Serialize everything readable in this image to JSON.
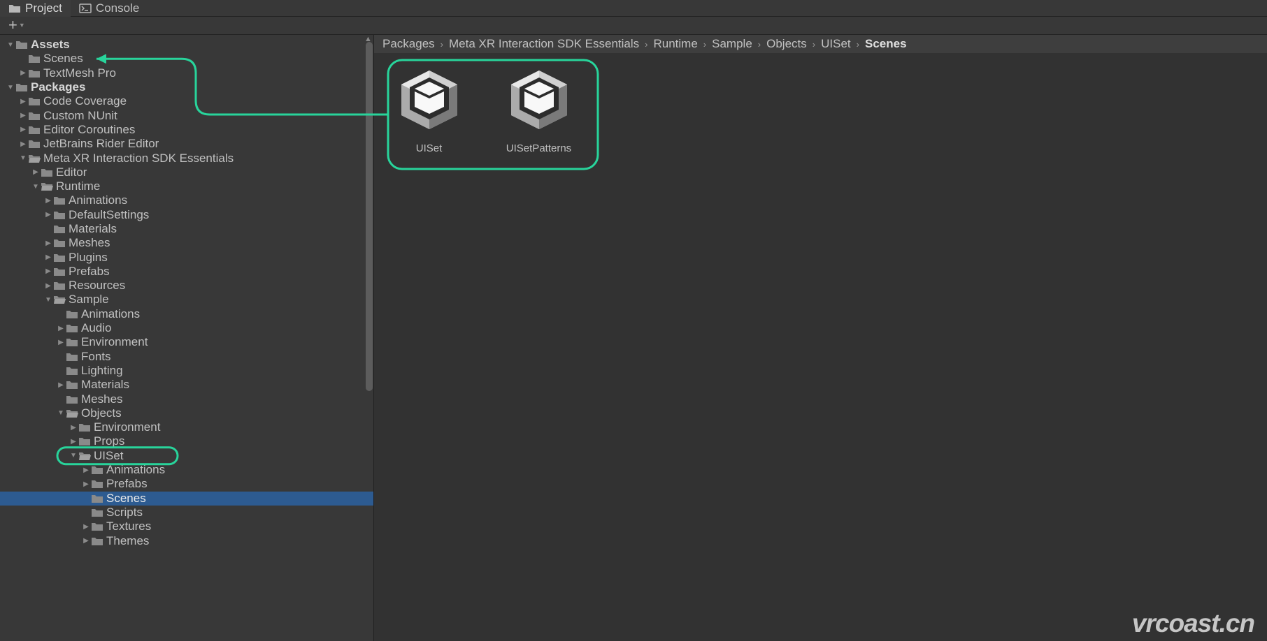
{
  "tabs": {
    "project": "Project",
    "console": "Console"
  },
  "tree": [
    {
      "id": "assets",
      "indent": 0,
      "fold": "down",
      "bold": true,
      "icon": "folder",
      "label": "Assets"
    },
    {
      "id": "assets-scenes",
      "indent": 1,
      "fold": "none",
      "icon": "folder",
      "label": "Scenes"
    },
    {
      "id": "assets-tmp",
      "indent": 1,
      "fold": "right",
      "icon": "folder",
      "label": "TextMesh Pro"
    },
    {
      "id": "packages",
      "indent": 0,
      "fold": "down",
      "bold": true,
      "icon": "folder",
      "label": "Packages"
    },
    {
      "id": "pkg-codecov",
      "indent": 1,
      "fold": "right",
      "icon": "folder",
      "label": "Code Coverage"
    },
    {
      "id": "pkg-nunit",
      "indent": 1,
      "fold": "right",
      "icon": "folder",
      "label": "Custom NUnit"
    },
    {
      "id": "pkg-editcr",
      "indent": 1,
      "fold": "right",
      "icon": "folder",
      "label": "Editor Coroutines"
    },
    {
      "id": "pkg-rider",
      "indent": 1,
      "fold": "right",
      "icon": "folder",
      "label": "JetBrains Rider Editor"
    },
    {
      "id": "pkg-metaxr",
      "indent": 1,
      "fold": "down",
      "icon": "folder-open",
      "label": "Meta XR Interaction SDK Essentials"
    },
    {
      "id": "metaxr-editor",
      "indent": 2,
      "fold": "right",
      "icon": "folder",
      "label": "Editor"
    },
    {
      "id": "metaxr-runtime",
      "indent": 2,
      "fold": "down",
      "icon": "folder-open",
      "label": "Runtime"
    },
    {
      "id": "rt-anim",
      "indent": 3,
      "fold": "right",
      "icon": "folder",
      "label": "Animations"
    },
    {
      "id": "rt-defset",
      "indent": 3,
      "fold": "right",
      "icon": "folder",
      "label": "DefaultSettings"
    },
    {
      "id": "rt-mat",
      "indent": 3,
      "fold": "none",
      "icon": "folder",
      "label": "Materials"
    },
    {
      "id": "rt-meshes",
      "indent": 3,
      "fold": "right",
      "icon": "folder",
      "label": "Meshes"
    },
    {
      "id": "rt-plugins",
      "indent": 3,
      "fold": "right",
      "icon": "folder",
      "label": "Plugins"
    },
    {
      "id": "rt-prefabs",
      "indent": 3,
      "fold": "right",
      "icon": "folder",
      "label": "Prefabs"
    },
    {
      "id": "rt-res",
      "indent": 3,
      "fold": "right",
      "icon": "folder",
      "label": "Resources"
    },
    {
      "id": "rt-sample",
      "indent": 3,
      "fold": "down",
      "icon": "folder-open",
      "label": "Sample"
    },
    {
      "id": "sm-anim",
      "indent": 4,
      "fold": "none",
      "icon": "folder",
      "label": "Animations"
    },
    {
      "id": "sm-audio",
      "indent": 4,
      "fold": "right",
      "icon": "folder",
      "label": "Audio"
    },
    {
      "id": "sm-env",
      "indent": 4,
      "fold": "right",
      "icon": "folder",
      "label": "Environment"
    },
    {
      "id": "sm-fonts",
      "indent": 4,
      "fold": "none",
      "icon": "folder",
      "label": "Fonts"
    },
    {
      "id": "sm-light",
      "indent": 4,
      "fold": "none",
      "icon": "folder",
      "label": "Lighting"
    },
    {
      "id": "sm-mat",
      "indent": 4,
      "fold": "right",
      "icon": "folder",
      "label": "Materials"
    },
    {
      "id": "sm-meshes",
      "indent": 4,
      "fold": "none",
      "icon": "folder",
      "label": "Meshes"
    },
    {
      "id": "sm-objects",
      "indent": 4,
      "fold": "down",
      "icon": "folder-open",
      "label": "Objects"
    },
    {
      "id": "obj-env",
      "indent": 5,
      "fold": "right",
      "icon": "folder",
      "label": "Environment"
    },
    {
      "id": "obj-props",
      "indent": 5,
      "fold": "right",
      "icon": "folder",
      "label": "Props"
    },
    {
      "id": "obj-uiset",
      "indent": 5,
      "fold": "down",
      "icon": "folder-open",
      "label": "UISet"
    },
    {
      "id": "ui-anim",
      "indent": 6,
      "fold": "right",
      "icon": "folder",
      "label": "Animations"
    },
    {
      "id": "ui-prefabs",
      "indent": 6,
      "fold": "right",
      "icon": "folder",
      "label": "Prefabs"
    },
    {
      "id": "ui-scenes",
      "indent": 6,
      "fold": "none",
      "icon": "folder",
      "label": "Scenes",
      "selected": true
    },
    {
      "id": "ui-scripts",
      "indent": 6,
      "fold": "none",
      "icon": "folder",
      "label": "Scripts"
    },
    {
      "id": "ui-tex",
      "indent": 6,
      "fold": "right",
      "icon": "folder",
      "label": "Textures"
    },
    {
      "id": "ui-themes",
      "indent": 6,
      "fold": "right",
      "icon": "folder",
      "label": "Themes"
    }
  ],
  "breadcrumb": [
    "Packages",
    "Meta XR Interaction SDK Essentials",
    "Runtime",
    "Sample",
    "Objects",
    "UISet",
    "Scenes"
  ],
  "assets": [
    {
      "id": "uiset",
      "label": "UISet"
    },
    {
      "id": "uisetpatterns",
      "label": "UISetPatterns"
    }
  ],
  "watermark": "vrcoast.cn",
  "colors": {
    "highlight": "#28d49b",
    "selection": "#2d5b91"
  }
}
